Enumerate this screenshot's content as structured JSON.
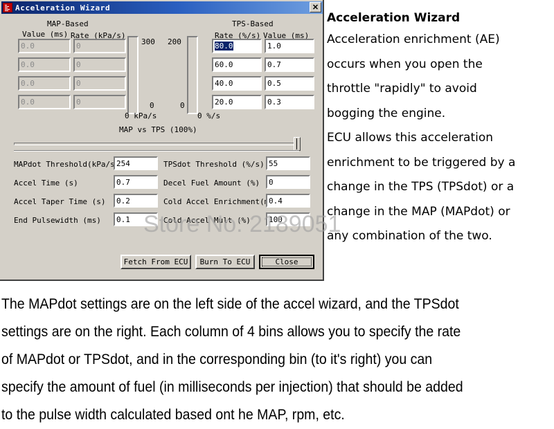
{
  "window": {
    "title": "Acceleration Wizard",
    "icon": "app-icon",
    "close_label": "✕"
  },
  "map_group": {
    "title": "MAP-Based",
    "value_header": "Value (ms)",
    "rate_header": "Rate (kPa/s)",
    "rows": [
      {
        "value": "0.0",
        "rate": "0"
      },
      {
        "value": "0.0",
        "rate": "0"
      },
      {
        "value": "0.0",
        "rate": "0"
      },
      {
        "value": "0.0",
        "rate": "0"
      }
    ],
    "enabled": false
  },
  "tps_group": {
    "title": "TPS-Based",
    "rate_header": "Rate (%/s)",
    "value_header": "Value (ms)",
    "rows": [
      {
        "rate": "80.0",
        "value": "1.0",
        "rate_selected": true
      },
      {
        "rate": "60.0",
        "value": "0.7",
        "rate_selected": false
      },
      {
        "rate": "40.0",
        "value": "0.5",
        "rate_selected": false
      },
      {
        "rate": "20.0",
        "value": "0.3",
        "rate_selected": false
      }
    ]
  },
  "gauges": {
    "map": {
      "max_label": "300",
      "min_label": "0",
      "unit_label": "0 kPa/s",
      "fill_percent": 0
    },
    "tps": {
      "max_label": "200",
      "min_label": "0",
      "unit_label": "0 %/s",
      "fill_percent": 0
    }
  },
  "blend": {
    "label": "MAP vs TPS (100%)",
    "slider_percent": 100
  },
  "settings": {
    "left": [
      {
        "label": "MAPdot Threshold(kPa/s)",
        "value": "254"
      },
      {
        "label": "Accel Time (s)",
        "value": "0.7"
      },
      {
        "label": "Accel Taper Time (s)",
        "value": "0.2"
      },
      {
        "label": "End Pulsewidth (ms)",
        "value": "0.1"
      }
    ],
    "right": [
      {
        "label": "TPSdot Threshold (%/s)",
        "value": "55"
      },
      {
        "label": "Decel Fuel Amount (%)",
        "value": "0"
      },
      {
        "label": "Cold Accel Enrichment(ms)",
        "value": "0.4"
      },
      {
        "label": "Cold Accel Mult (%)",
        "value": "100"
      }
    ]
  },
  "buttons": {
    "fetch": "Fetch From ECU",
    "burn": "Burn To ECU",
    "close": "Close"
  },
  "watermark": "Store No: 2189051",
  "right_panel": {
    "title": "Acceleration Wizard",
    "lines": [
      "Acceleration enrichment (AE)",
      "occurs when you open the",
      "throttle \"rapidly\" to avoid",
      "bogging the engine.",
      "ECU allows this acceleration",
      "enrichment to be triggered by a",
      "change in the TPS (TPSdot) or a",
      "change in the MAP (MAPdot) or",
      "any combination of the two."
    ]
  },
  "bottom_paragraph": {
    "lines": [
      "The MAPdot settings are on the left side of the accel wizard, and the TPSdot",
      "settings are on the right. Each column of 4 bins allows you to specify the rate",
      "of MAPdot or TPSdot, and in the corresponding bin (to it's right) you can",
      "specify the amount of fuel (in milliseconds per injection) that should be added",
      "to the pulse width calculated based ont he MAP, rpm, etc."
    ]
  },
  "colors": {
    "dialog_face": "#d4d0c8",
    "titlebar_start": "#0a246a",
    "titlebar_end": "#6f9fe0",
    "selection": "#0a246a",
    "text": "#000000"
  }
}
